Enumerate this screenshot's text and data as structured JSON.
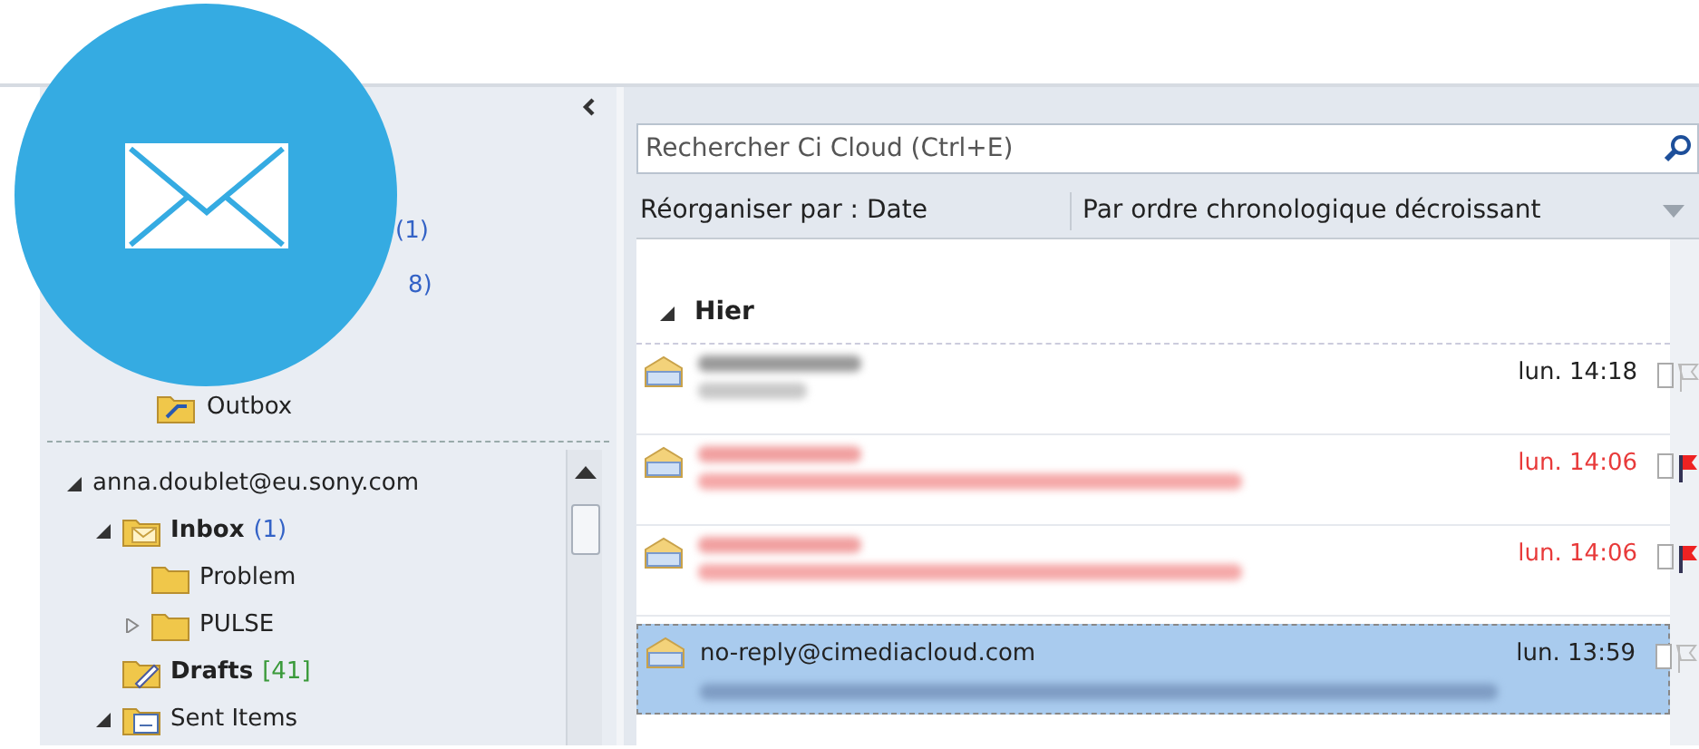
{
  "favorites": {
    "counts": [
      "(1)",
      "8)"
    ],
    "outbox": "Outbox"
  },
  "account": {
    "name": "anna.doublet@eu.sony.com",
    "expanded": true,
    "folders": [
      {
        "kind": "inbox",
        "name": "Inbox",
        "count": "(1)",
        "expanded": true,
        "children": [
          {
            "kind": "folder",
            "name": "Problem"
          },
          {
            "kind": "folder",
            "name": "PULSE",
            "expanded": false
          }
        ]
      },
      {
        "kind": "drafts",
        "name": "Drafts",
        "count": "[41]"
      },
      {
        "kind": "sent",
        "name": "Sent Items",
        "expanded": true
      }
    ]
  },
  "search": {
    "placeholder": "Rechercher Ci Cloud (Ctrl+E)"
  },
  "arrange": {
    "by": "Réorganiser par : Date",
    "order": "Par ordre chronologique décroissant"
  },
  "group": {
    "label": "Hier",
    "expanded": true
  },
  "messages": [
    {
      "time": "lun. 14:18",
      "flagged": false,
      "selected": false
    },
    {
      "time": "lun. 14:06",
      "flagged": true,
      "selected": false
    },
    {
      "time": "lun. 14:06",
      "flagged": true,
      "selected": false
    },
    {
      "sender": "no-reply@cimediacloud.com",
      "time": "lun. 13:59",
      "flagged": false,
      "selected": true
    }
  ]
}
